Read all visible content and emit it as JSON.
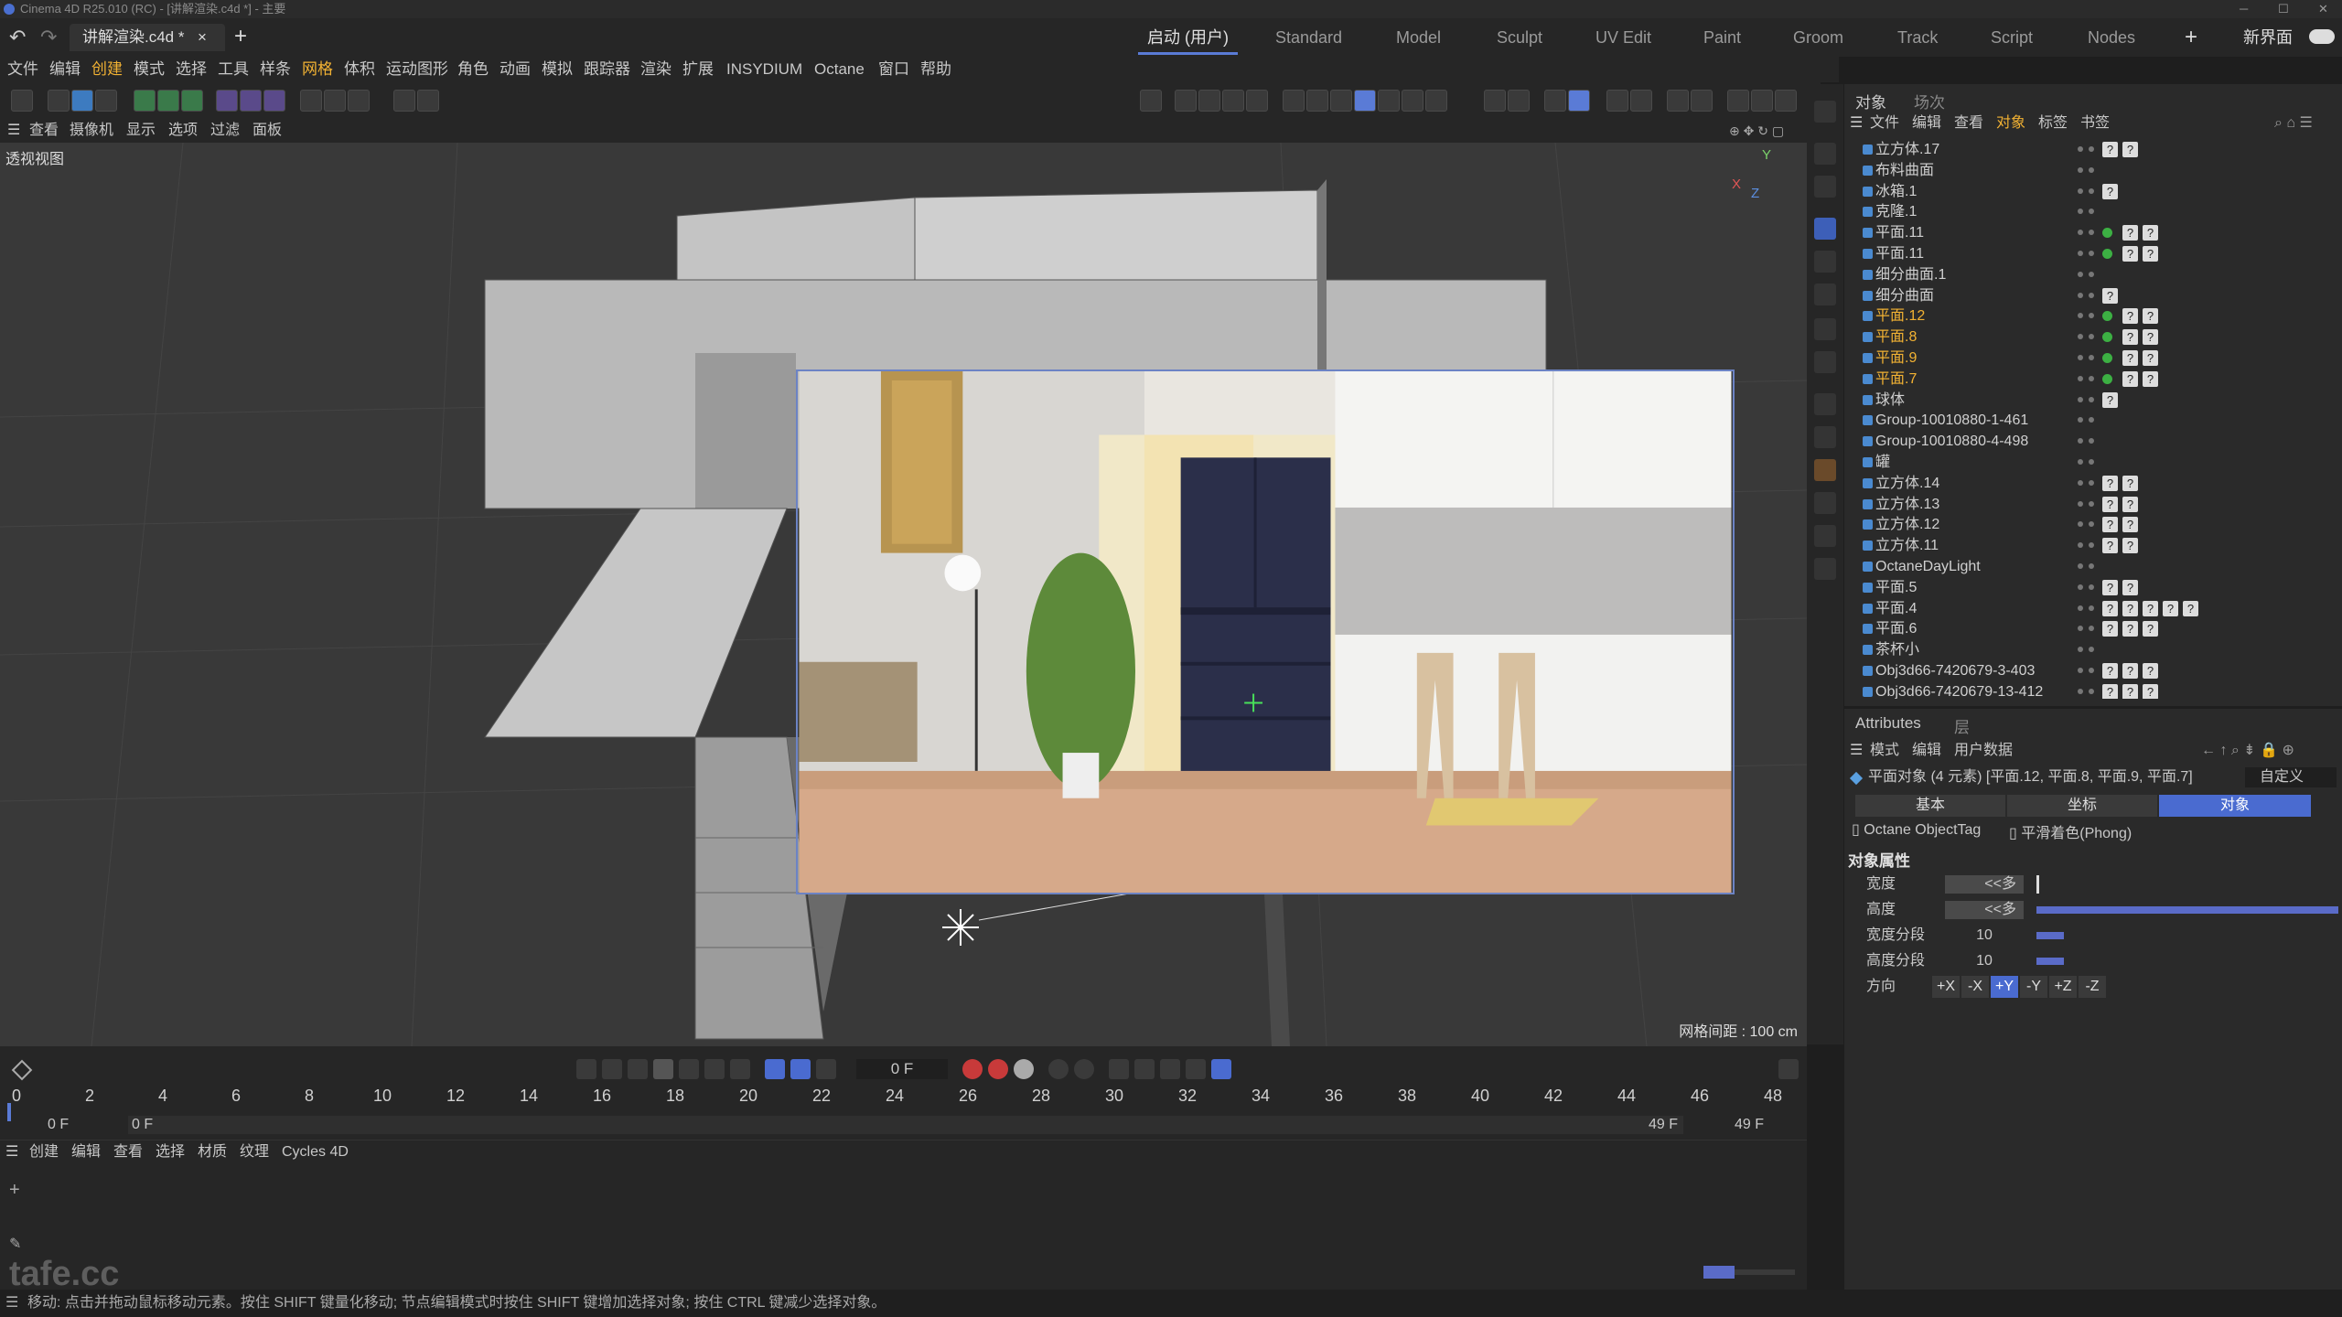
{
  "titlebar": {
    "title": "Cinema 4D R25.010 (RC) - [讲解渲染.c4d *] - 主要"
  },
  "doc_tab": {
    "label": "讲解渲染.c4d *",
    "close": "×",
    "add": "+"
  },
  "layouts": [
    "启动 (用户)",
    "Standard",
    "Model",
    "Sculpt",
    "UV Edit",
    "Paint",
    "Groom",
    "Track",
    "Script",
    "Nodes"
  ],
  "layout_add": "+",
  "layout_new": "新界面",
  "menu": [
    "文件",
    "编辑",
    "创建",
    "模式",
    "选择",
    "工具",
    "样条",
    "网格",
    "体积",
    "运动图形",
    "角色",
    "动画",
    "模拟",
    "跟踪器",
    "渲染",
    "扩展",
    "INSYDIUM",
    "Octane",
    "窗口",
    "帮助"
  ],
  "vp_menu": [
    "查看",
    "摄像机",
    "显示",
    "选项",
    "过滤",
    "面板"
  ],
  "viewport": {
    "label": "透视视图",
    "grid_distance": "网格间距 : 100 cm"
  },
  "object_panel": {
    "tabs": [
      "对象",
      "场次"
    ],
    "menu": [
      "文件",
      "编辑",
      "查看",
      "对象",
      "标签",
      "书签"
    ],
    "rows": [
      {
        "name": "立方体.17",
        "sel": false,
        "tags": [
          "q",
          "q"
        ]
      },
      {
        "name": "布料曲面",
        "sel": false,
        "tags": []
      },
      {
        "name": "冰箱.1",
        "sel": false,
        "tags": [
          "q"
        ]
      },
      {
        "name": "克隆.1",
        "sel": false,
        "tags": []
      },
      {
        "name": "平面.11",
        "sel": false,
        "tags": [
          "g",
          "q",
          "q"
        ]
      },
      {
        "name": "平面.11",
        "sel": false,
        "tags": [
          "g",
          "q",
          "q"
        ]
      },
      {
        "name": "细分曲面.1",
        "sel": false,
        "tags": []
      },
      {
        "name": "细分曲面",
        "sel": false,
        "tags": [
          "q"
        ]
      },
      {
        "name": "平面.12",
        "sel": true,
        "tags": [
          "g",
          "q",
          "q"
        ]
      },
      {
        "name": "平面.8",
        "sel": true,
        "tags": [
          "g",
          "q",
          "q"
        ]
      },
      {
        "name": "平面.9",
        "sel": true,
        "tags": [
          "g",
          "q",
          "q"
        ]
      },
      {
        "name": "平面.7",
        "sel": true,
        "tags": [
          "g",
          "q",
          "q"
        ]
      },
      {
        "name": "球体",
        "sel": false,
        "tags": [
          "q"
        ]
      },
      {
        "name": "Group-10010880-1-461",
        "sel": false,
        "tags": []
      },
      {
        "name": "Group-10010880-4-498",
        "sel": false,
        "tags": []
      },
      {
        "name": "罐",
        "sel": false,
        "tags": []
      },
      {
        "name": "立方体.14",
        "sel": false,
        "tags": [
          "q",
          "q"
        ]
      },
      {
        "name": "立方体.13",
        "sel": false,
        "tags": [
          "q",
          "q"
        ]
      },
      {
        "name": "立方体.12",
        "sel": false,
        "tags": [
          "q",
          "q"
        ]
      },
      {
        "name": "立方体.11",
        "sel": false,
        "tags": [
          "q",
          "q"
        ]
      },
      {
        "name": "OctaneDayLight",
        "sel": false,
        "tags": []
      },
      {
        "name": "平面.5",
        "sel": false,
        "tags": [
          "q",
          "q"
        ]
      },
      {
        "name": "平面.4",
        "sel": false,
        "tags": [
          "q",
          "q",
          "?",
          "?",
          "?"
        ]
      },
      {
        "name": "平面.6",
        "sel": false,
        "tags": [
          "q",
          "q",
          "?"
        ]
      },
      {
        "name": "茶杯小",
        "sel": false,
        "tags": []
      },
      {
        "name": "Obj3d66-7420679-3-403",
        "sel": false,
        "tags": [
          "q",
          "q",
          "?"
        ]
      },
      {
        "name": "Obj3d66-7420679-13-412",
        "sel": false,
        "tags": [
          "q",
          "q",
          "?"
        ]
      }
    ]
  },
  "attributes": {
    "tabs": [
      "Attributes",
      "层"
    ],
    "menu": [
      "模式",
      "编辑",
      "用户数据"
    ],
    "object_line": "平面对象 (4 元素) [平面.12, 平面.8, 平面.9, 平面.7]",
    "preset": "自定义",
    "subtabs": [
      "基本",
      "坐标",
      "对象"
    ],
    "tags": [
      "Octane ObjectTag",
      "平滑着色(Phong)"
    ],
    "section": "对象属性",
    "props": [
      {
        "label": "宽度",
        "value": "<<多"
      },
      {
        "label": "高度",
        "value": "<<多"
      },
      {
        "label": "宽度分段",
        "value": "10"
      },
      {
        "label": "高度分段",
        "value": "10"
      },
      {
        "label": "方向",
        "value": ""
      }
    ],
    "orientations": [
      "+X",
      "-X",
      "+Y",
      "-Y",
      "+Z",
      "-Z"
    ]
  },
  "timeline": {
    "current_frame": "0 F",
    "ticks": [
      "0",
      "2",
      "4",
      "6",
      "8",
      "10",
      "12",
      "14",
      "16",
      "18",
      "20",
      "22",
      "24",
      "26",
      "28",
      "30",
      "32",
      "34",
      "36",
      "38",
      "40",
      "42",
      "44",
      "46",
      "48"
    ],
    "start": "0 F",
    "start2": "0 F",
    "end": "49 F",
    "end2": "49 F"
  },
  "material_menu": [
    "创建",
    "编辑",
    "查看",
    "选择",
    "材质",
    "纹理",
    "Cycles 4D"
  ],
  "status": "移动: 点击并拖动鼠标移动元素。按住 SHIFT 键量化移动; 节点编辑模式时按住 SHIFT 键增加选择对象; 按住 CTRL 键减少选择对象。",
  "watermark": "tafe.cc",
  "colors": {
    "accent": "#5a7bd6",
    "selected": "#f2b233",
    "bg": "#262626",
    "viewport": "#3a3a3a"
  }
}
